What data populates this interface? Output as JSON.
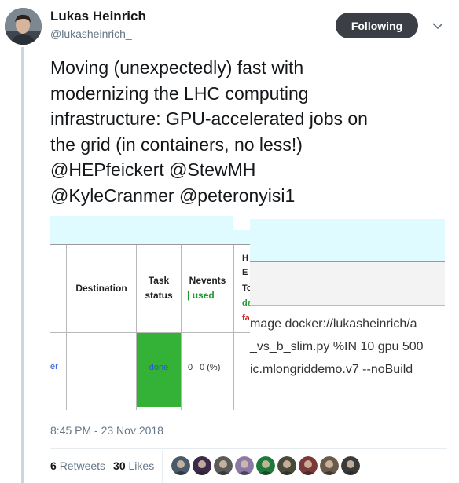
{
  "author": {
    "name": "Lukas Heinrich",
    "handle": "@lukasheinrich_"
  },
  "follow_button": {
    "label": "Following"
  },
  "tweet": {
    "text": "Moving (unexpectedly) fast with\nmodernizing the LHC computing\ninfrastructure: GPU-accelerated jobs on\nthe grid (in containers, no less!)\n@HEPfeickert @StewMH\n@KyleCranmer @peteronyisi1",
    "timestamp": "8:45 PM - 23 Nov 2018"
  },
  "media": {
    "table": {
      "col_destination": "Destination",
      "col_task_status": "Task\nstatus",
      "col_nevents": "Nevents",
      "col_nevents_used": "| used",
      "row_left_fragment": "er",
      "row_status": "done",
      "row_nevents": "0 | 0 (%)",
      "peek_letters": [
        "H",
        "E",
        "To"
      ],
      "peek_green": "de",
      "peek_red": "fa"
    },
    "command": {
      "line1": "mage docker://lukasheinrich/a",
      "line2": "_vs_b_slim.py %IN 10 gpu 500",
      "line3": "ic.mlongriddemo.v7 --noBuild"
    }
  },
  "stats": {
    "retweets_count": "6",
    "retweets_label": "Retweets",
    "likes_count": "30",
    "likes_label": "Likes"
  },
  "likers": [
    {
      "color": "#4a5a6a"
    },
    {
      "color": "#3b2b4a"
    },
    {
      "color": "#5a5a5a"
    },
    {
      "color": "#8a7aa8"
    },
    {
      "color": "#1e7a3a"
    },
    {
      "color": "#4a4a3a"
    },
    {
      "color": "#7a3a3a"
    },
    {
      "color": "#6a5a4a"
    },
    {
      "color": "#3a3a3a"
    }
  ]
}
